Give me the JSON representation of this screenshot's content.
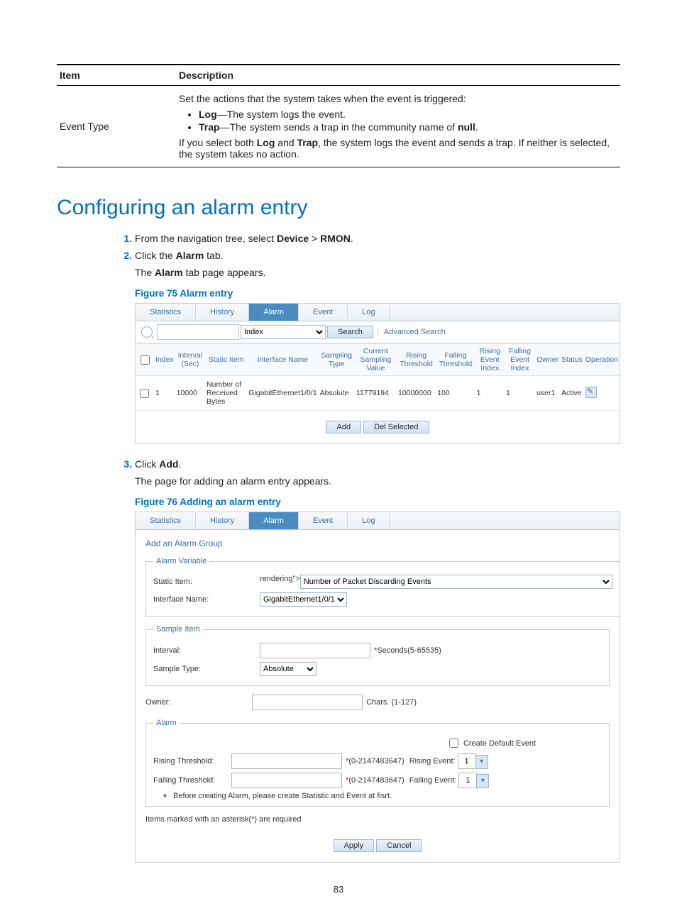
{
  "defTable": {
    "head": {
      "item": "Item",
      "desc": "Description"
    },
    "row": {
      "item": "Event Type",
      "intro": "Set the actions that the system takes when the event is triggered:",
      "b1_label": "Log",
      "b1_rest": "—The system logs the event.",
      "b2_label": "Trap",
      "b2_rest": "—The system sends a trap in the community name of ",
      "b2_tail": "null",
      "post1": "If you select both ",
      "post_log": "Log",
      "post_mid": " and ",
      "post_trap": "Trap",
      "post2": ", the system logs the event and sends a trap. If neither is selected, the system takes no action."
    }
  },
  "heading": "Configuring an alarm entry",
  "step1": {
    "pre": "From the navigation tree, select ",
    "dev": "Device",
    "gt": " > ",
    "rmon": "RMON",
    "dot": "."
  },
  "step2": {
    "pre": "Click the ",
    "alarm": "Alarm",
    "post": " tab."
  },
  "step2_body": {
    "a": "The ",
    "b": "Alarm",
    "c": " tab page appears."
  },
  "fig75": "Figure 75 Alarm entry",
  "screenshot1": {
    "tabs": [
      "Statistics",
      "History",
      "Alarm",
      "Event",
      "Log"
    ],
    "dropdown": "Index",
    "search_btn": "Search",
    "advanced": "Advanced Search",
    "headers": [
      "",
      "Index",
      "Interval (Sec)",
      "Static Item",
      "Interface Name",
      "Sampling Type",
      "Current Sampling Value",
      "Rising Threshold",
      "Falling Threshold",
      "Rising Event Index",
      "Falling Event Index",
      "Owner",
      "Status",
      "Operation"
    ],
    "row": {
      "index": "1",
      "interval": "10000",
      "static": "Number of Received Bytes",
      "ifname": "GigabitEthernet1/0/1",
      "stype": "Absolute",
      "curval": "11779194",
      "rising": "10000000",
      "falling": "100",
      "revent": "1",
      "fevent": "1",
      "owner": "user1",
      "status": "Active"
    },
    "add_btn": "Add",
    "del_btn": "Del Selected"
  },
  "step3": {
    "pre": "Click ",
    "add": "Add",
    "dot": "."
  },
  "step3_body": "The page for adding an alarm entry appears.",
  "fig76": "Figure 76 Adding an alarm entry",
  "screenshot2": {
    "tabs": [
      "Statistics",
      "History",
      "Alarm",
      "Event",
      "Log"
    ],
    "form_title": "Add an Alarm Group",
    "grp1": {
      "legend": "Alarm Variable",
      "static_label": "Static Item:",
      "static_value": "Number of Packet Discarding Events",
      "if_label": "Interface Name:",
      "if_value": "GigabitEthernet1/0/1"
    },
    "grp2": {
      "legend": "Sample Item",
      "interval_label": "Interval:",
      "interval_hint": "Seconds(5-65535)",
      "sample_label": "Sample Type:",
      "sample_value": "Absolute"
    },
    "owner_label": "Owner:",
    "owner_hint": "Chars. (1-127)",
    "grp3": {
      "legend": "Alarm",
      "create_default": "Create Default Event",
      "rising_label": "Rising Threshold:",
      "range_hint": "(0-2147483647)",
      "rising_event_label": "Rising Event:",
      "falling_label": "Falling Threshold:",
      "falling_event_label": "Falling Event:",
      "event_val": "1"
    },
    "note": "Before creating Alarm, please create Statistic and Event at fisrt.",
    "footnote": "Items marked with an asterisk(*) are required",
    "apply": "Apply",
    "cancel": "Cancel"
  },
  "pagenum": "83"
}
